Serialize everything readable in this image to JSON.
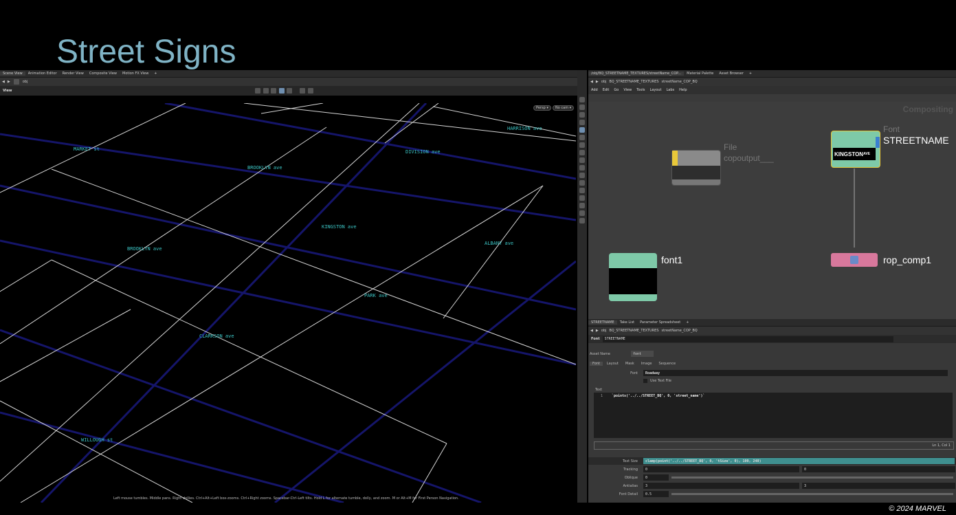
{
  "slide": {
    "title": "Street Signs",
    "copyright": "© 2024 MARVEL"
  },
  "left_panel": {
    "tabs": [
      "Scene View",
      "Animation Editor",
      "Render View",
      "Composite View",
      "Motion FX View"
    ],
    "path": "obj",
    "view_label": "View",
    "persp_label": "Persp ▾",
    "nocam_label": "No cam ▾",
    "status_text": "Left mouse tumbles. Middle pans. Right dollies. Ctrl+Alt+Left box-zooms. Ctrl+Right zooms. Spacebar-Ctrl-Left tilts. Hold L for alternate tumble, dolly, and zoom.    M or Alt+M for First Person Navigation.",
    "streets": [
      "MARKET st",
      "HARRISON ave",
      "BROOKLYN ave",
      "DIVISION ave",
      "KINGSTON ave",
      "ALBANY ave",
      "BROOKLYN ave",
      "PARK ave",
      "CLARKSON ave",
      "WILLOUGH st"
    ]
  },
  "network": {
    "tabs": [
      "/obj/BQ_STREETNAME_TEXTURES/streetName_COP...",
      "Material Palette",
      "Asset Browser"
    ],
    "path_items": [
      "obj",
      "BQ_STREETNAME_TEXTURES",
      "streetName_COP_BQ"
    ],
    "menu": [
      "Add",
      "Edit",
      "Go",
      "View",
      "Tools",
      "Layout",
      "Labs",
      "Help"
    ],
    "context_label": "Compositing",
    "nodes": {
      "file": {
        "type": "File",
        "name": "copoutput___"
      },
      "font_main": {
        "type": "Font",
        "name": "STREETNAME",
        "preview_text": "KINGSTON",
        "preview_sup": "AVE"
      },
      "font1": {
        "name": "font1"
      },
      "rop": {
        "name": "rop_comp1"
      }
    }
  },
  "params": {
    "tabs": [
      "STREETNAME",
      "Take List",
      "Parameter Spreadsheet"
    ],
    "path_items": [
      "obj",
      "BQ_STREETNAME_TEXTURES",
      "streetName_COP_BQ"
    ],
    "node_type": "Font",
    "node_name": "STREETNAME",
    "asset_name_label": "Asset Name",
    "asset_name_value": "font",
    "sub_tabs": [
      "Font",
      "Layout",
      "Mask",
      "Image",
      "Sequence"
    ],
    "font_label": "Font",
    "font_value": "Roadway",
    "use_text_file": "Use Text File",
    "text_label": "Text",
    "line_no": "1",
    "code": "`points('../../STREET_BQ', 0, 'street_name')`",
    "cursor_pos": "Ln 1, Col 1",
    "rows": [
      {
        "label": "Text Size",
        "value": "clamp(point('../../STREET_BQ', 0, 'tSize', 0), 100, 240)"
      },
      {
        "label": "Tracking",
        "value": "0",
        "value2": "0"
      },
      {
        "label": "Oblique",
        "value": "0"
      },
      {
        "label": "Antialias",
        "value": "3",
        "value2": "3"
      },
      {
        "label": "Font Detail",
        "value": "0.5"
      }
    ]
  },
  "colors": {
    "title": "#7fb3c5",
    "street_text": "#3cc4c4",
    "grid_line": "#d8d8d8",
    "blue_line": "#15156a",
    "font_node": "#7ec9a8",
    "rop_node": "#d8789c"
  }
}
